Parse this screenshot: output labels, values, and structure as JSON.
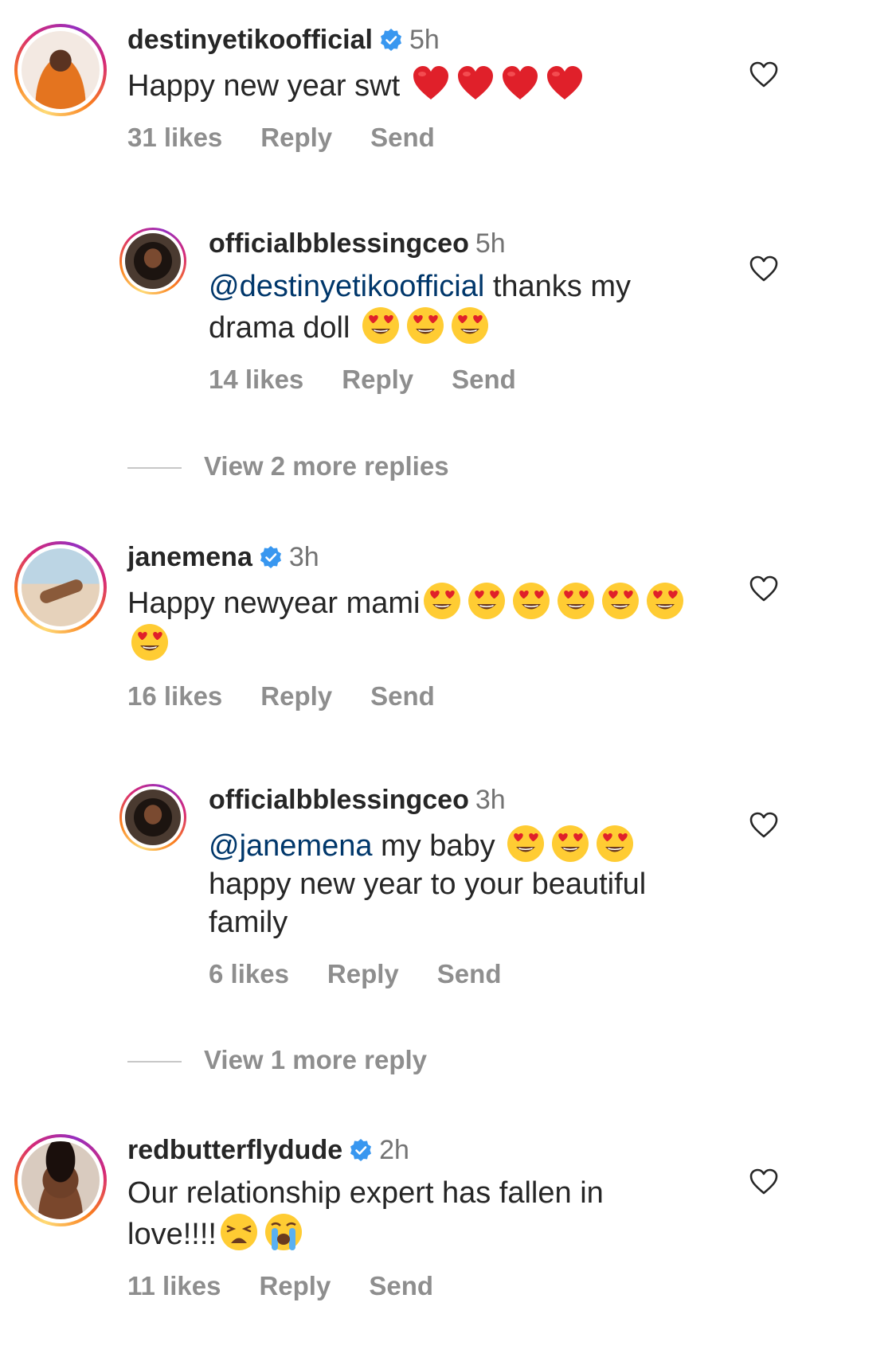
{
  "comments": [
    {
      "username": "destinyetikoofficial",
      "time": "5h",
      "text": "Happy new year swt",
      "likes": "31 likes",
      "reply": "Reply",
      "send": "Send",
      "emojis": [
        "heart-emoji",
        "heart-emoji",
        "heart-emoji",
        "heart-emoji"
      ]
    },
    {
      "username": "officialbblessingceo",
      "time": "5h",
      "mention": "@destinyetikoofficial",
      "text_a": " thanks my",
      "text_b": "drama doll",
      "likes": "14 likes",
      "reply": "Reply",
      "send": "Send",
      "emojis": [
        "heart-eyes-emoji",
        "heart-eyes-emoji",
        "heart-eyes-emoji"
      ]
    },
    {
      "username": "janemena",
      "time": "3h",
      "text": "Happy newyear mami",
      "likes": "16 likes",
      "reply": "Reply",
      "send": "Send",
      "emojis": [
        "heart-eyes-emoji",
        "heart-eyes-emoji",
        "heart-eyes-emoji",
        "heart-eyes-emoji",
        "heart-eyes-emoji",
        "heart-eyes-emoji",
        "heart-eyes-emoji"
      ]
    },
    {
      "username": "officialbblessingceo",
      "time": "3h",
      "mention": "@janemena",
      "text_a": " my baby",
      "text_b": "happy new year to your beautiful",
      "text_c": "family",
      "likes": "6 likes",
      "reply": "Reply",
      "send": "Send",
      "emojis": [
        "heart-eyes-emoji",
        "heart-eyes-emoji",
        "heart-eyes-emoji"
      ]
    },
    {
      "username": "redbutterflydude",
      "time": "2h",
      "text_a": "Our relationship expert has fallen in",
      "text_b": "love!!!!",
      "likes": "11 likes",
      "reply": "Reply",
      "send": "Send",
      "emojis": [
        "weary-face-emoji",
        "crying-face-emoji"
      ]
    }
  ],
  "view_more": [
    "View 2 more replies",
    "View 1 more reply"
  ],
  "colors": {
    "text": "#262626",
    "meta": "#8e8e8e",
    "mention": "#00376b",
    "verified": "#3897f0"
  }
}
